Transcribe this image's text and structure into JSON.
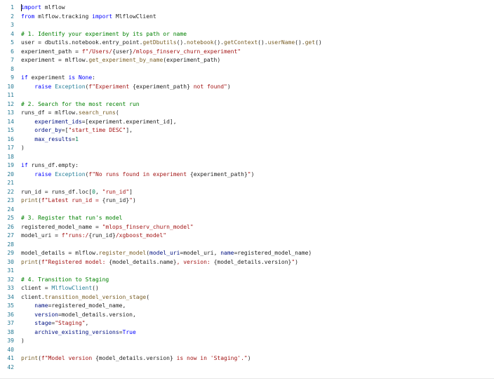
{
  "colors": {
    "line_number": "#237893",
    "keyword": "#0000ff",
    "comment": "#008000",
    "string": "#a31515",
    "function": "#795e26",
    "type": "#267f99",
    "variable": "#001080",
    "number": "#098658",
    "plain": "#1f1f1f"
  },
  "editor": {
    "lines": [
      {
        "num": "1",
        "tokens": [
          {
            "t": "import",
            "c": "keyword"
          },
          {
            "t": " mlflow",
            "c": "plain"
          }
        ]
      },
      {
        "num": "2",
        "tokens": [
          {
            "t": "from",
            "c": "keyword"
          },
          {
            "t": " mlflow.tracking ",
            "c": "plain"
          },
          {
            "t": "import",
            "c": "keyword"
          },
          {
            "t": " MlflowClient",
            "c": "plain"
          }
        ]
      },
      {
        "num": "3",
        "tokens": []
      },
      {
        "num": "4",
        "tokens": [
          {
            "t": "# 1. Identify your experiment by its path or name",
            "c": "comment"
          }
        ]
      },
      {
        "num": "5",
        "tokens": [
          {
            "t": "user = dbutils.notebook.entry_point.",
            "c": "plain"
          },
          {
            "t": "getDbutils",
            "c": "function"
          },
          {
            "t": "().",
            "c": "plain"
          },
          {
            "t": "notebook",
            "c": "function"
          },
          {
            "t": "().",
            "c": "plain"
          },
          {
            "t": "getContext",
            "c": "function"
          },
          {
            "t": "().",
            "c": "plain"
          },
          {
            "t": "userName",
            "c": "function"
          },
          {
            "t": "().",
            "c": "plain"
          },
          {
            "t": "get",
            "c": "function"
          },
          {
            "t": "()",
            "c": "plain"
          }
        ]
      },
      {
        "num": "6",
        "tokens": [
          {
            "t": "experiment_path = ",
            "c": "plain"
          },
          {
            "t": "f\"/Users/",
            "c": "string"
          },
          {
            "t": "{user}",
            "c": "plain"
          },
          {
            "t": "/mlops_finserv_churn_experiment\"",
            "c": "string"
          }
        ]
      },
      {
        "num": "7",
        "tokens": [
          {
            "t": "experiment = mlflow.",
            "c": "plain"
          },
          {
            "t": "get_experiment_by_name",
            "c": "function"
          },
          {
            "t": "(experiment_path)",
            "c": "plain"
          }
        ]
      },
      {
        "num": "8",
        "tokens": []
      },
      {
        "num": "9",
        "tokens": [
          {
            "t": "if",
            "c": "keyword"
          },
          {
            "t": " experiment ",
            "c": "plain"
          },
          {
            "t": "is",
            "c": "keyword"
          },
          {
            "t": " ",
            "c": "plain"
          },
          {
            "t": "None",
            "c": "keyword"
          },
          {
            "t": ":",
            "c": "plain"
          }
        ]
      },
      {
        "num": "10",
        "tokens": [
          {
            "t": "    ",
            "c": "plain"
          },
          {
            "t": "raise",
            "c": "keyword"
          },
          {
            "t": " ",
            "c": "plain"
          },
          {
            "t": "Exception",
            "c": "type"
          },
          {
            "t": "(",
            "c": "plain"
          },
          {
            "t": "f\"Experiment ",
            "c": "string"
          },
          {
            "t": "{experiment_path}",
            "c": "plain"
          },
          {
            "t": " not found\"",
            "c": "string"
          },
          {
            "t": ")",
            "c": "plain"
          }
        ]
      },
      {
        "num": "11",
        "tokens": []
      },
      {
        "num": "12",
        "tokens": [
          {
            "t": "# 2. Search for the most recent run",
            "c": "comment"
          }
        ]
      },
      {
        "num": "13",
        "tokens": [
          {
            "t": "runs_df = mlflow.",
            "c": "plain"
          },
          {
            "t": "search_runs",
            "c": "function"
          },
          {
            "t": "(",
            "c": "plain"
          }
        ]
      },
      {
        "num": "14",
        "tokens": [
          {
            "t": "    ",
            "c": "plain"
          },
          {
            "t": "experiment_ids",
            "c": "variable"
          },
          {
            "t": "=[experiment.experiment_id],",
            "c": "plain"
          }
        ]
      },
      {
        "num": "15",
        "tokens": [
          {
            "t": "    ",
            "c": "plain"
          },
          {
            "t": "order_by",
            "c": "variable"
          },
          {
            "t": "=[",
            "c": "plain"
          },
          {
            "t": "\"start_time DESC\"",
            "c": "string"
          },
          {
            "t": "],",
            "c": "plain"
          }
        ]
      },
      {
        "num": "16",
        "tokens": [
          {
            "t": "    ",
            "c": "plain"
          },
          {
            "t": "max_results",
            "c": "variable"
          },
          {
            "t": "=",
            "c": "plain"
          },
          {
            "t": "1",
            "c": "number"
          }
        ]
      },
      {
        "num": "17",
        "tokens": [
          {
            "t": ")",
            "c": "plain"
          }
        ]
      },
      {
        "num": "18",
        "tokens": []
      },
      {
        "num": "19",
        "tokens": [
          {
            "t": "if",
            "c": "keyword"
          },
          {
            "t": " runs_df.empty:",
            "c": "plain"
          }
        ]
      },
      {
        "num": "20",
        "tokens": [
          {
            "t": "    ",
            "c": "plain"
          },
          {
            "t": "raise",
            "c": "keyword"
          },
          {
            "t": " ",
            "c": "plain"
          },
          {
            "t": "Exception",
            "c": "type"
          },
          {
            "t": "(",
            "c": "plain"
          },
          {
            "t": "f\"No runs found in experiment ",
            "c": "string"
          },
          {
            "t": "{experiment_path}",
            "c": "plain"
          },
          {
            "t": "\"",
            "c": "string"
          },
          {
            "t": ")",
            "c": "plain"
          }
        ]
      },
      {
        "num": "21",
        "tokens": []
      },
      {
        "num": "22",
        "tokens": [
          {
            "t": "run_id = runs_df.loc[",
            "c": "plain"
          },
          {
            "t": "0",
            "c": "number"
          },
          {
            "t": ", ",
            "c": "plain"
          },
          {
            "t": "\"run_id\"",
            "c": "string"
          },
          {
            "t": "]",
            "c": "plain"
          }
        ]
      },
      {
        "num": "23",
        "tokens": [
          {
            "t": "print",
            "c": "function"
          },
          {
            "t": "(",
            "c": "plain"
          },
          {
            "t": "f\"Latest run_id = ",
            "c": "string"
          },
          {
            "t": "{run_id}",
            "c": "plain"
          },
          {
            "t": "\"",
            "c": "string"
          },
          {
            "t": ")",
            "c": "plain"
          }
        ]
      },
      {
        "num": "24",
        "tokens": []
      },
      {
        "num": "25",
        "tokens": [
          {
            "t": "# 3. Register that run's model",
            "c": "comment"
          }
        ]
      },
      {
        "num": "26",
        "tokens": [
          {
            "t": "registered_model_name = ",
            "c": "plain"
          },
          {
            "t": "\"mlops_finserv_churn_model\"",
            "c": "string"
          }
        ]
      },
      {
        "num": "27",
        "tokens": [
          {
            "t": "model_uri = ",
            "c": "plain"
          },
          {
            "t": "f\"runs:/",
            "c": "string"
          },
          {
            "t": "{run_id}",
            "c": "plain"
          },
          {
            "t": "/xgboost_model\"",
            "c": "string"
          }
        ]
      },
      {
        "num": "28",
        "tokens": []
      },
      {
        "num": "29",
        "tokens": [
          {
            "t": "model_details = mlflow.",
            "c": "plain"
          },
          {
            "t": "register_model",
            "c": "function"
          },
          {
            "t": "(",
            "c": "plain"
          },
          {
            "t": "model_uri",
            "c": "variable"
          },
          {
            "t": "=model_uri, ",
            "c": "plain"
          },
          {
            "t": "name",
            "c": "variable"
          },
          {
            "t": "=registered_model_name)",
            "c": "plain"
          }
        ]
      },
      {
        "num": "30",
        "tokens": [
          {
            "t": "print",
            "c": "function"
          },
          {
            "t": "(",
            "c": "plain"
          },
          {
            "t": "f\"Registered model: ",
            "c": "string"
          },
          {
            "t": "{model_details.name}",
            "c": "plain"
          },
          {
            "t": ", version: ",
            "c": "string"
          },
          {
            "t": "{model_details.version}",
            "c": "plain"
          },
          {
            "t": "\"",
            "c": "string"
          },
          {
            "t": ")",
            "c": "plain"
          }
        ]
      },
      {
        "num": "31",
        "tokens": []
      },
      {
        "num": "32",
        "tokens": [
          {
            "t": "# 4. Transition to Staging",
            "c": "comment"
          }
        ]
      },
      {
        "num": "33",
        "tokens": [
          {
            "t": "client = ",
            "c": "plain"
          },
          {
            "t": "MlflowClient",
            "c": "type"
          },
          {
            "t": "()",
            "c": "plain"
          }
        ]
      },
      {
        "num": "34",
        "tokens": [
          {
            "t": "client.",
            "c": "plain"
          },
          {
            "t": "transition_model_version_stage",
            "c": "function"
          },
          {
            "t": "(",
            "c": "plain"
          }
        ]
      },
      {
        "num": "35",
        "tokens": [
          {
            "t": "    ",
            "c": "plain"
          },
          {
            "t": "name",
            "c": "variable"
          },
          {
            "t": "=registered_model_name,",
            "c": "plain"
          }
        ]
      },
      {
        "num": "36",
        "tokens": [
          {
            "t": "    ",
            "c": "plain"
          },
          {
            "t": "version",
            "c": "variable"
          },
          {
            "t": "=model_details.version,",
            "c": "plain"
          }
        ]
      },
      {
        "num": "37",
        "tokens": [
          {
            "t": "    ",
            "c": "plain"
          },
          {
            "t": "stage",
            "c": "variable"
          },
          {
            "t": "=",
            "c": "plain"
          },
          {
            "t": "\"Staging\"",
            "c": "string"
          },
          {
            "t": ",",
            "c": "plain"
          }
        ]
      },
      {
        "num": "38",
        "tokens": [
          {
            "t": "    ",
            "c": "plain"
          },
          {
            "t": "archive_existing_versions",
            "c": "variable"
          },
          {
            "t": "=",
            "c": "plain"
          },
          {
            "t": "True",
            "c": "keyword"
          }
        ]
      },
      {
        "num": "39",
        "tokens": [
          {
            "t": ")",
            "c": "plain"
          }
        ]
      },
      {
        "num": "40",
        "tokens": []
      },
      {
        "num": "41",
        "tokens": [
          {
            "t": "print",
            "c": "function"
          },
          {
            "t": "(",
            "c": "plain"
          },
          {
            "t": "f\"Model version ",
            "c": "string"
          },
          {
            "t": "{model_details.version}",
            "c": "plain"
          },
          {
            "t": " is now in 'Staging'.\"",
            "c": "string"
          },
          {
            "t": ")",
            "c": "plain"
          }
        ]
      },
      {
        "num": "42",
        "tokens": []
      }
    ]
  }
}
